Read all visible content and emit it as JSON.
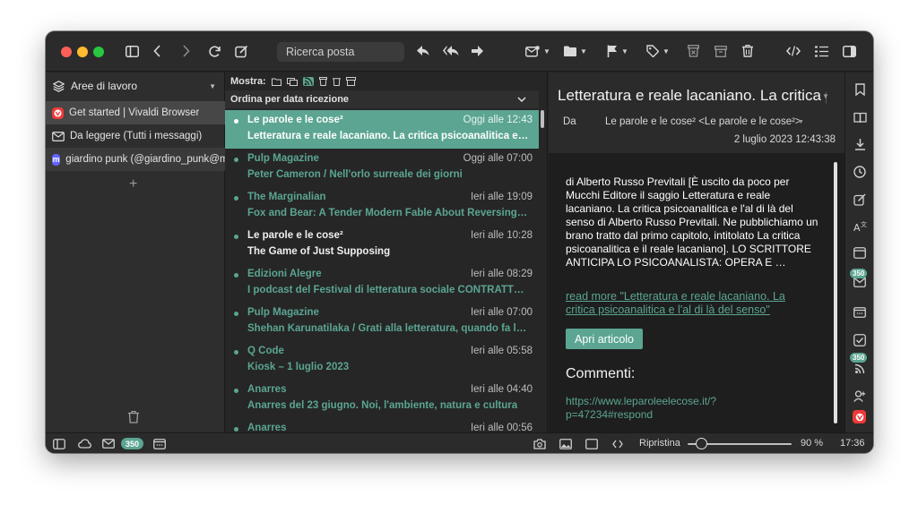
{
  "toolbar": {
    "search_placeholder": "Ricerca posta"
  },
  "left_panel": {
    "header": "Aree di lavoro",
    "accounts": [
      {
        "label": "Get started | Vivaldi Browser"
      },
      {
        "label": "Da leggere (Tutti i messaggi)"
      },
      {
        "label": "giardino punk (@giardino_punk@mastodon.uno)"
      }
    ]
  },
  "message_list": {
    "show_label": "Mostra:",
    "sort_label": "Ordina per data ricezione",
    "messages": [
      {
        "from": "Le parole e le cose²",
        "time": "Oggi alle 12:43",
        "subject": "Letteratura e reale lacaniano. La critica psicoanalitica e l'al di là del senso"
      },
      {
        "from": "Pulp Magazine",
        "time": "Oggi alle 07:00",
        "subject": "Peter Cameron / Nell'orlo surreale dei giorni"
      },
      {
        "from": "The Marginalian",
        "time": "Ieri alle 19:09",
        "subject": "Fox and Bear: A Tender Modern Fable About Reversing the Roles"
      },
      {
        "from": "Le parole e le cose²",
        "time": "Ieri alle 10:28",
        "subject": "The Game of Just Supposing"
      },
      {
        "from": "Edizioni Alegre",
        "time": "Ieri alle 08:29",
        "subject": "I podcast del Festival di letteratura sociale CONTRATTEMPO"
      },
      {
        "from": "Pulp Magazine",
        "time": "Ieri alle 07:00",
        "subject": "Shehan Karunatilaka / Grati alla letteratura, quando fa la differenza"
      },
      {
        "from": "Q Code",
        "time": "Ieri alle 05:58",
        "subject": "Kiosk – 1 luglio 2023"
      },
      {
        "from": "Anarres",
        "time": "Ieri alle 04:40",
        "subject": "Anarres del 23 giugno. Noi, l'ambiente, natura e cultura"
      },
      {
        "from": "Anarres",
        "time": "Ieri alle 00:56",
        "subject": ""
      }
    ]
  },
  "reading_pane": {
    "title": "Letteratura e reale lacaniano. La critica psicoanalitica e l'al di là del senso",
    "from_label": "Da",
    "from": "Le parole e le cose² <Le parole e le cose²>",
    "date": "2 luglio 2023 12:43:38",
    "body": "di Alberto Russo Previtali   [È uscito da poco per Mucchi Editore il saggio Letteratura e reale lacaniano. La critica psicoanalitica e l'al di là del senso di Alberto Russo Previtali. Ne pubblichiamo un brano tratto dal primo capitolo, intitolato La critica psicoanalitica e il reale lacaniano].   LO SCRITTORE ANTICIPA LO PSICOANALISTA: OPERA E …",
    "read_more": "read more \"Letteratura e reale lacaniano. La critica psicoanalitica e l'al di là del senso\"",
    "open_button": "Apri articolo",
    "comments_heading": "Commenti:",
    "comments_url": "https://www.leparoleelecose.it/?p=47234#respond"
  },
  "side_bar": {
    "badge_count_1": "350",
    "badge_count_2": "350"
  },
  "status_bar": {
    "mail_badge": "350",
    "reset_label": "Ripristina",
    "zoom_level": "90 %",
    "zoom_fraction": 0.13,
    "clock": "17:36"
  },
  "colors": {
    "accent": "#5ba592",
    "window_bg": "#232323",
    "vivaldi_red": "#ef3939"
  }
}
